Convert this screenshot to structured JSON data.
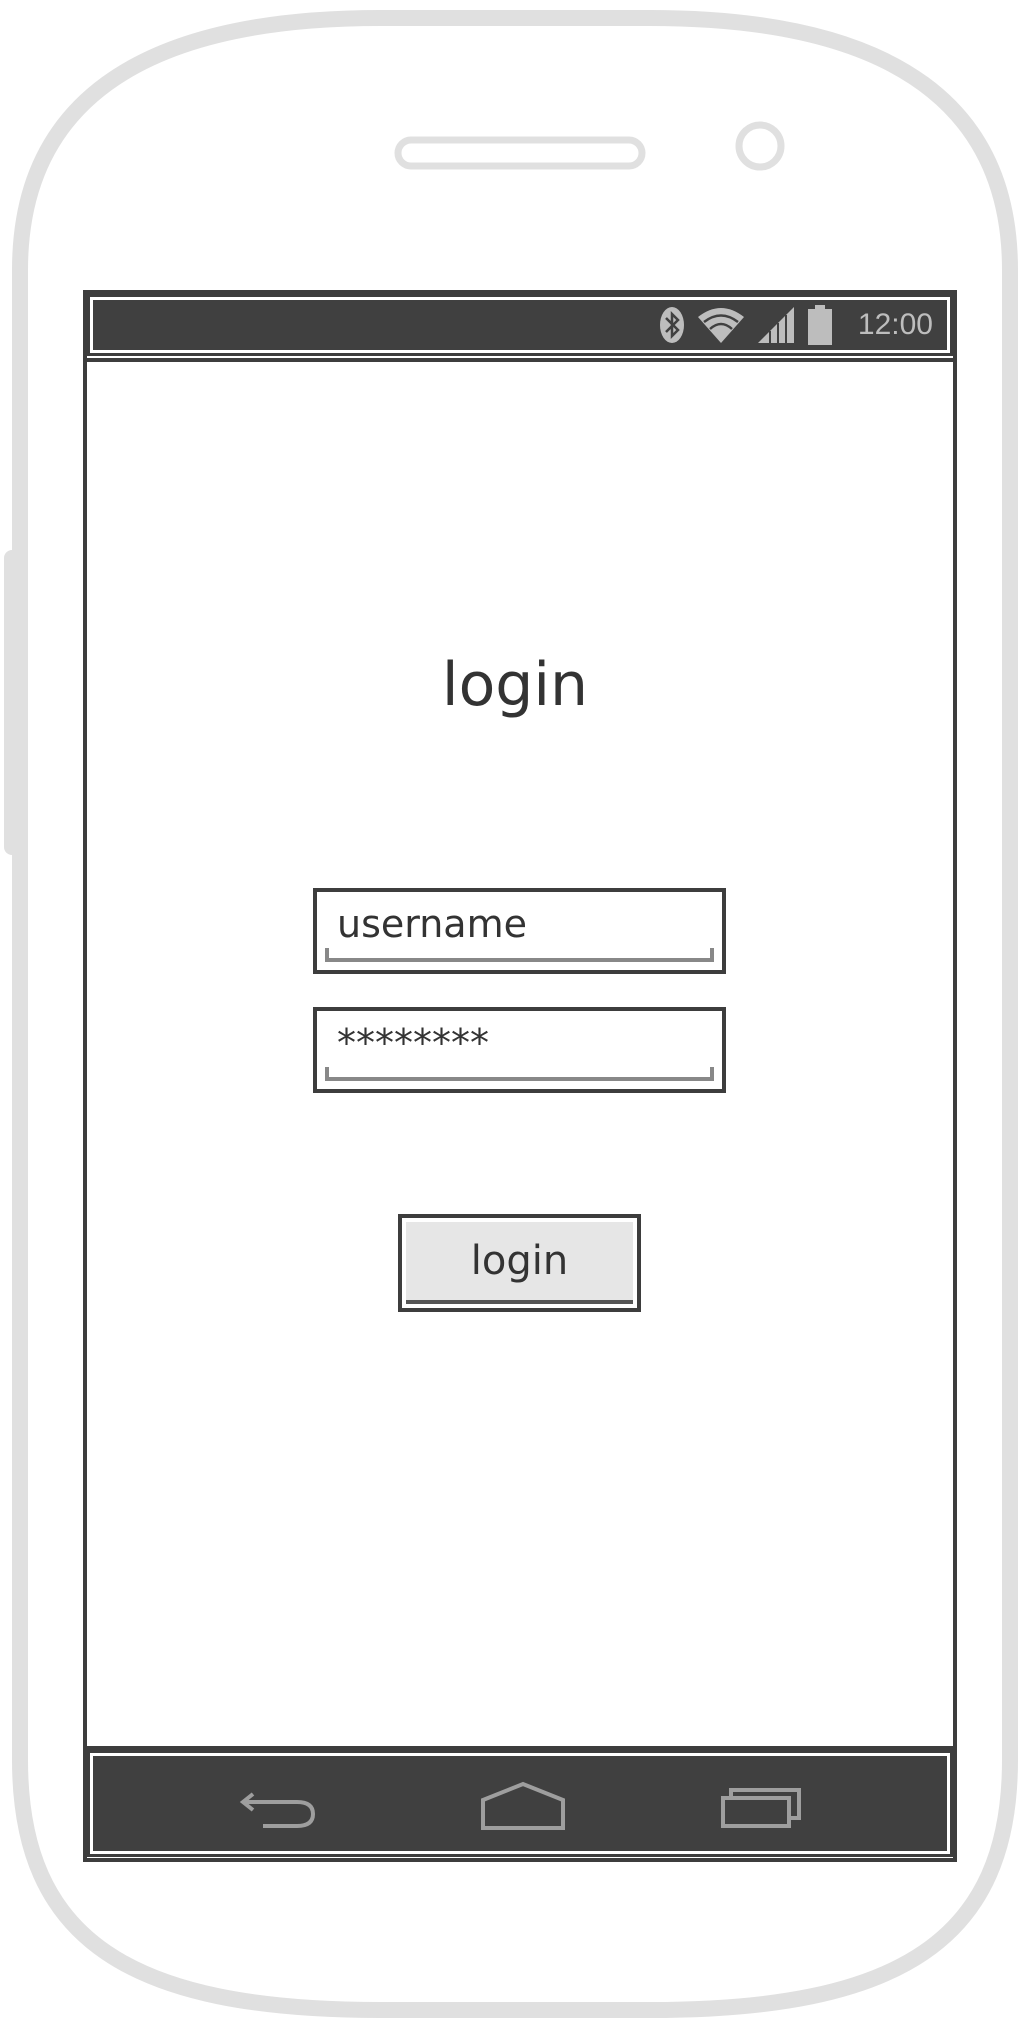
{
  "status_bar": {
    "time": "12:00",
    "icons": [
      "bluetooth-icon",
      "wifi-icon",
      "signal-icon",
      "battery-icon"
    ]
  },
  "screen": {
    "title": "login",
    "username_field": {
      "placeholder": "username",
      "value": ""
    },
    "password_field": {
      "value": "********"
    },
    "login_button": {
      "label": "login"
    }
  },
  "nav_bar": {
    "icons": [
      "back-icon",
      "home-icon",
      "recent-apps-icon"
    ]
  },
  "colors": {
    "frame": "#e0e0e0",
    "bar": "#404040",
    "outline": "#3d3d3d",
    "button_face": "#e6e6e6"
  }
}
